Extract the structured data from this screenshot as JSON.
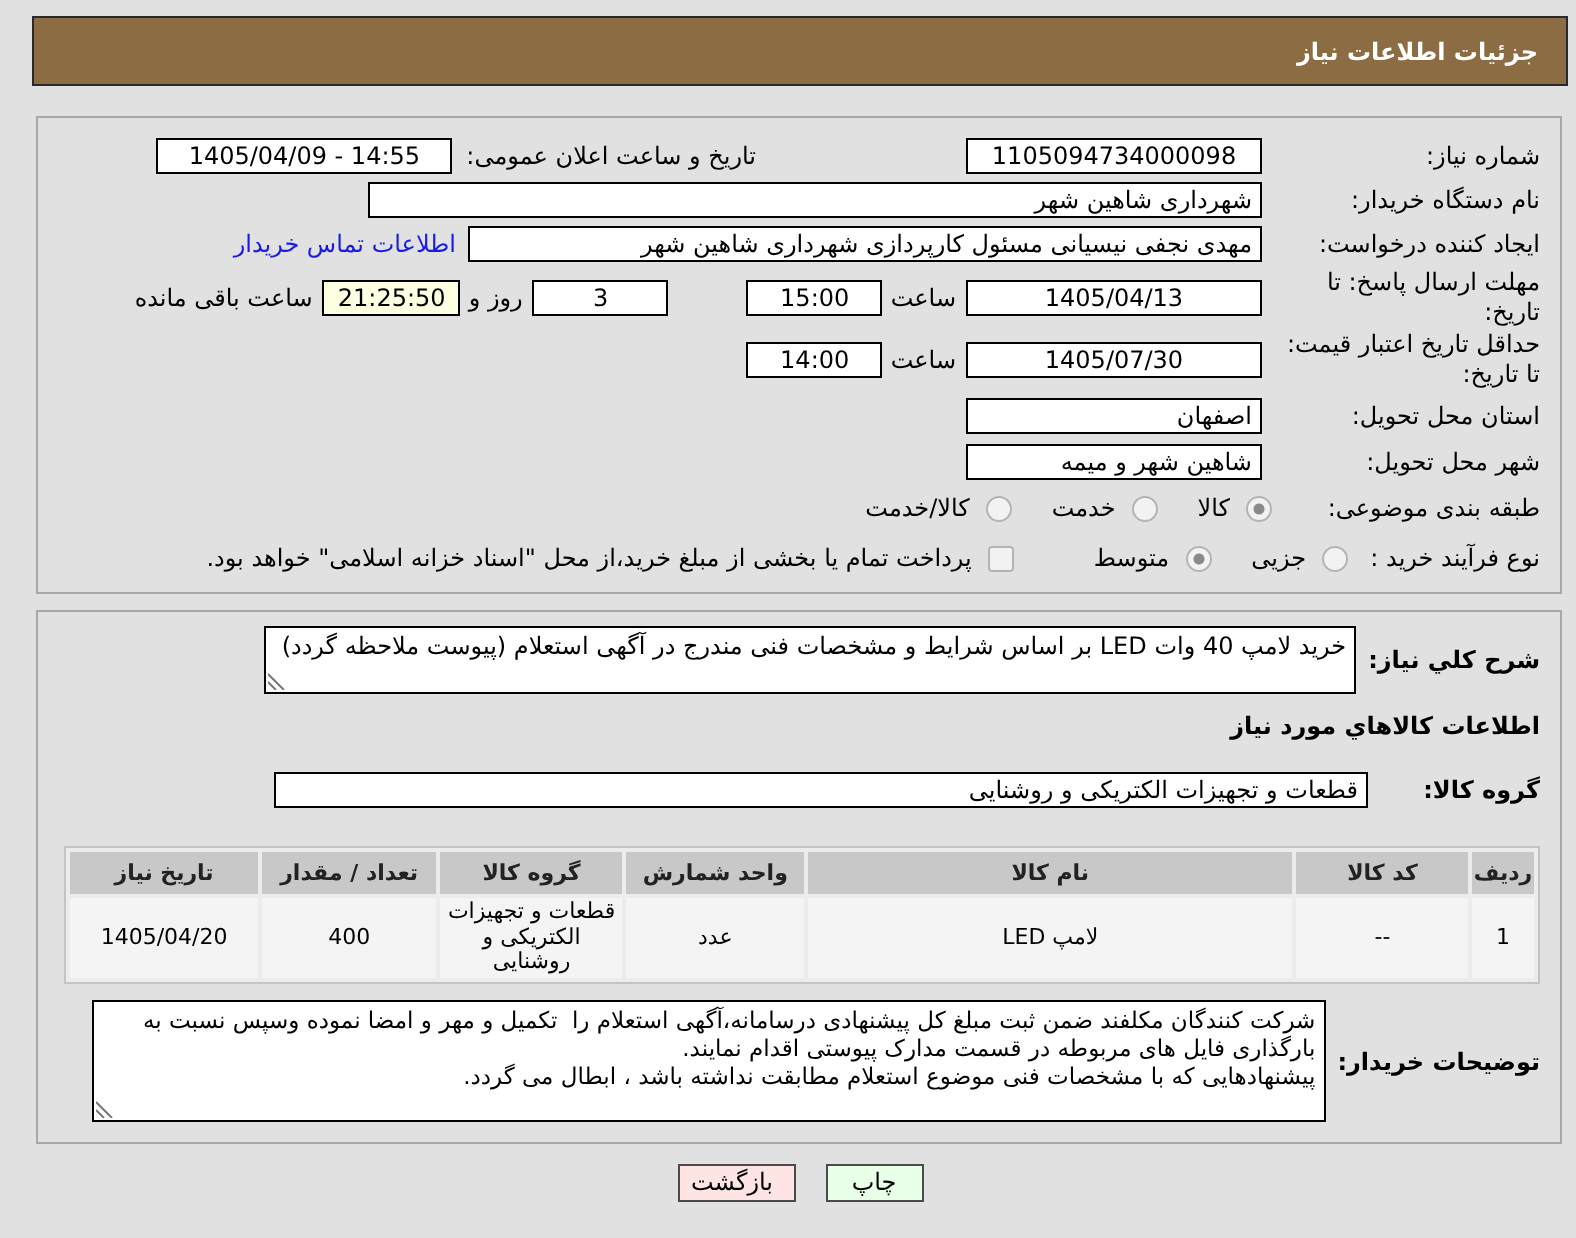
{
  "header": {
    "title": "جزئیات اطلاعات نیاز"
  },
  "details": {
    "need_number": {
      "label": "شماره نیاز:",
      "value": "1105094734000098"
    },
    "announce": {
      "label": "تاریخ و ساعت اعلان عمومی:",
      "value": "1405/04/09 - 14:55"
    },
    "buyer_org": {
      "label": "نام دستگاه خریدار:",
      "value": "شهرداری شاهین شهر"
    },
    "requester": {
      "label": "ایجاد کننده درخواست:",
      "value": "مهدی نجفی نیسیانی مسئول کارپردازی شهرداری شاهین شهر",
      "link": "اطلاعات تماس خریدار"
    },
    "reply_deadline": {
      "label": "مهلت ارسال پاسخ: تا تاریخ:",
      "date": "1405/04/13",
      "time_label": "ساعت",
      "time": "15:00",
      "days": "3",
      "days_label": "روز و",
      "remaining": "21:25:50",
      "remaining_label": "ساعت باقی مانده"
    },
    "price_validity": {
      "label": "حداقل تاریخ اعتبار قیمت: تا تاریخ:",
      "date": "1405/07/30",
      "time_label": "ساعت",
      "time": "14:00"
    },
    "province": {
      "label": "استان محل تحویل:",
      "value": "اصفهان"
    },
    "city": {
      "label": "شهر محل تحویل:",
      "value": "شاهین شهر و میمه"
    },
    "category": {
      "label": "طبقه بندی موضوعی:",
      "options": [
        {
          "label": "کالا",
          "selected": true
        },
        {
          "label": "خدمت",
          "selected": false
        },
        {
          "label": "کالا/خدمت",
          "selected": false
        }
      ]
    },
    "purchase_type": {
      "label": "نوع فرآیند خرید :",
      "options": [
        {
          "label": "جزیی",
          "selected": false
        },
        {
          "label": "متوسط",
          "selected": true
        }
      ],
      "treasury": {
        "label": "پرداخت تمام یا بخشی از مبلغ خرید،از محل \"اسناد خزانه اسلامی\" خواهد بود.",
        "checked": false
      }
    }
  },
  "description": {
    "label": "شرح کلي نیاز:",
    "value": "خرید لامپ 40 وات LED بر اساس شرایط و مشخصات فنی مندرج در آگهی استعلام (پیوست ملاحظه گردد)"
  },
  "goods": {
    "title": "اطلاعات کالاهاي مورد نياز",
    "group": {
      "label": "گروه کالا:",
      "value": "قطعات و تجهیزات الکتریکی و روشنایی"
    },
    "table": {
      "columns": [
        "ردیف",
        "کد کالا",
        "نام کالا",
        "واحد شمارش",
        "گروه کالا",
        "تعداد / مقدار",
        "تاریخ نیاز"
      ],
      "rows": [
        [
          "1",
          "--",
          "لامپ LED",
          "عدد",
          "قطعات و تجهیزات الکتریکی و روشنایی",
          "400",
          "1405/04/20"
        ]
      ]
    }
  },
  "buyer_notes": {
    "label": "توضیحات خریدار:",
    "value": "شرکت کنندگان مکلفند ضمن ثبت مبلغ کل پیشنهادی درسامانه،آگهی استعلام را  تکمیل و مهر و امضا نموده وسپس نسبت به بارگذاری فایل های مربوطه در قسمت مدارک پیوستی اقدام نمایند.\nپیشنهادهایی که با مشخصات فنی موضوع استعلام مطابقت نداشته باشد ، ابطال می گردد."
  },
  "buttons": [
    {
      "label": "چاپ",
      "kind": "print"
    },
    {
      "label": "بازگشت",
      "kind": "back"
    }
  ]
}
